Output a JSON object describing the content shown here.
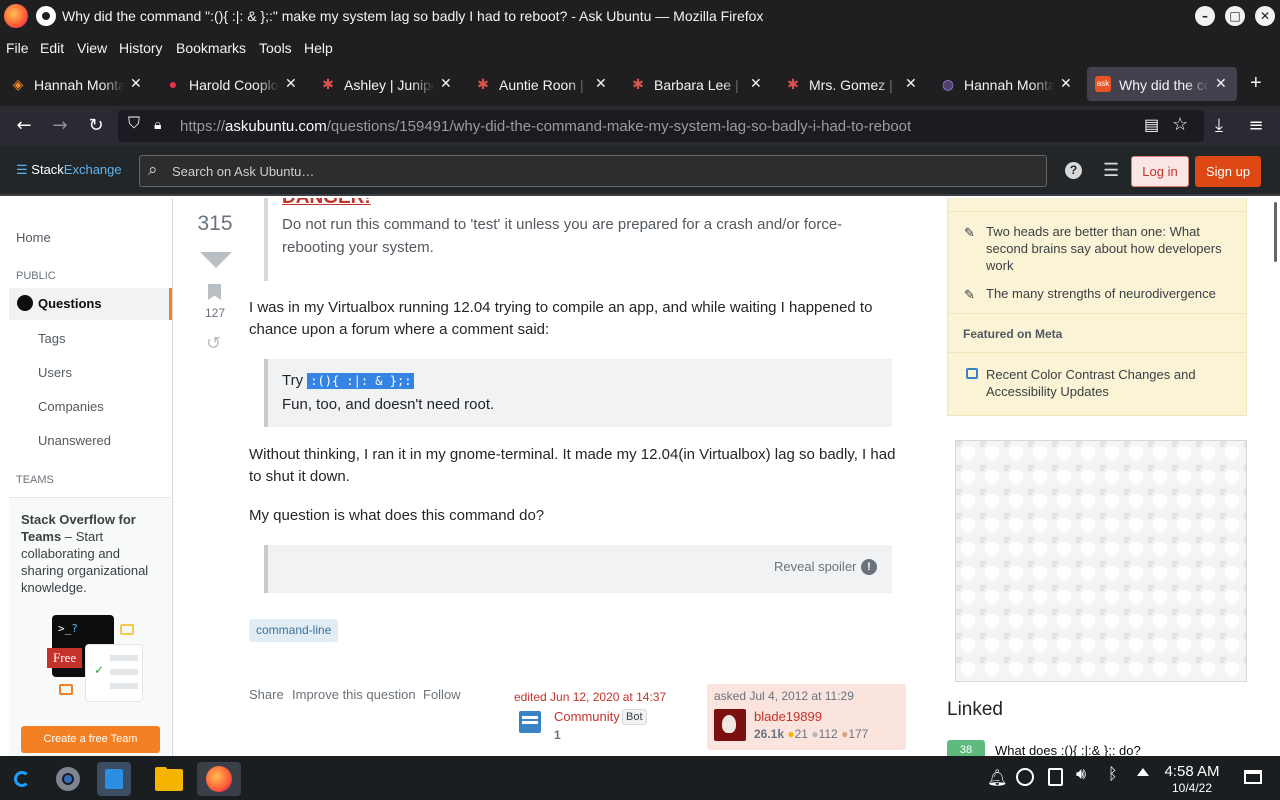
{
  "window": {
    "title": "Why did the command \":(){ :|: & };:\" make my system lag so badly I had to reboot? - Ask Ubuntu — Mozilla Firefox",
    "min_icon": "minimize-icon",
    "max_icon": "maximize-icon",
    "close_icon": "close-icon"
  },
  "menu": [
    "File",
    "Edit",
    "View",
    "History",
    "Bookmarks",
    "Tools",
    "Help"
  ],
  "tabs": [
    {
      "label": "Hannah Montana",
      "icon": "lightning-icon"
    },
    {
      "label": "Harold Cooplow",
      "icon": "flame-icon"
    },
    {
      "label": "Ashley | Juniper",
      "icon": "palm-icon"
    },
    {
      "label": "Auntie Roon | Ju",
      "icon": "palm-icon"
    },
    {
      "label": "Barbara Lee | Ju",
      "icon": "palm-icon"
    },
    {
      "label": "Mrs. Gomez | Ju",
      "icon": "palm-icon"
    },
    {
      "label": "Hannah Montana",
      "icon": "globe-icon"
    },
    {
      "label": "Why did the command",
      "icon": "askubuntu-icon"
    }
  ],
  "nav": {
    "url_prefix": "https://",
    "url_host": "askubuntu.com",
    "url_path": "/questions/159491/why-did-the-command-make-my-system-lag-so-badly-i-had-to-reboot"
  },
  "se": {
    "logo_a": "Stack",
    "logo_b": "Exchange",
    "search_placeholder": "Search on Ask Ubuntu…",
    "login": "Log in",
    "signup": "Sign up"
  },
  "leftnav": {
    "home": "Home",
    "public": "PUBLIC",
    "questions": "Questions",
    "tags": "Tags",
    "users": "Users",
    "companies": "Companies",
    "unanswered": "Unanswered",
    "teams": "TEAMS",
    "teams_title": "Stack Overflow for Teams",
    "teams_desc": "– Start collaborating and sharing organizational knowledge.",
    "free": "Free",
    "create_team": "Create a free Team"
  },
  "question": {
    "votes": "315",
    "bookmarks": "127",
    "danger": "DANGER!",
    "danger_text": "Do not run this command to 'test' it unless you are prepared for a crash and/or force-rebooting your system.",
    "p1": "I was in my Virtualbox running 12.04 trying to compile an app, and while waiting I happened to chance upon a forum where a comment said:",
    "quote_try": "Try",
    "quote_code": ":(){ :|: & };:",
    "quote_line2": "Fun, too, and doesn't need root.",
    "p2": "Without thinking, I ran it in my gnome-terminal. It made my 12.04(in Virtualbox) lag so badly, I had to shut it down.",
    "p3": "My question is what does this command do?",
    "reveal": "Reveal spoiler",
    "tag": "command-line",
    "share": "Share",
    "improve": "Improve this question",
    "follow": "Follow",
    "edited": "edited Jun 12, 2020 at 14:37",
    "editor": "Community",
    "editor_badge": "Bot",
    "editor_rep": "1",
    "asked": "asked Jul 4, 2012 at 11:29",
    "asker": "blade19899",
    "asker_rep": "26.1k",
    "gold": "21",
    "silver": "112",
    "bronze": "177"
  },
  "sidebar": {
    "blog1": "Two heads are better than one: What second brains say about how developers work",
    "blog2": "The many strengths of neurodivergence",
    "featured_meta": "Featured on Meta",
    "meta1": "Recent Color Contrast Changes and Accessibility Updates",
    "linked": "Linked",
    "linked_count": "38",
    "linked_q": "What does :(){ :|:& };: do?"
  },
  "taskbar": {
    "time": "4:58 AM",
    "date": "10/4/22"
  },
  "colors": {
    "accent": "#dd4814",
    "link": "#c4322a",
    "tag_bg": "#e1ecf4",
    "tag_fg": "#39739d"
  }
}
